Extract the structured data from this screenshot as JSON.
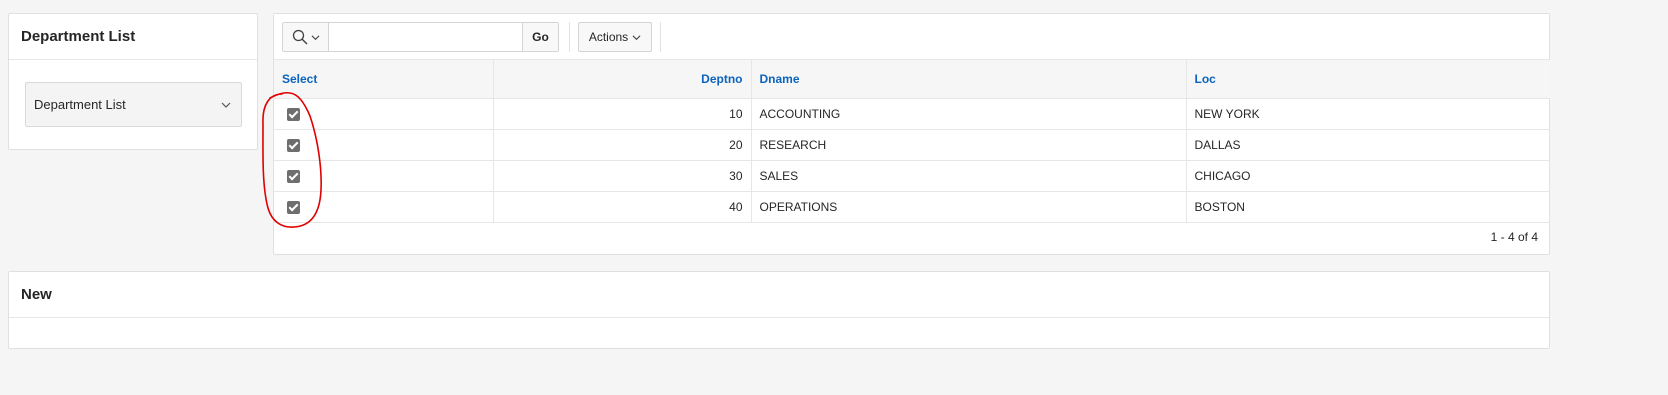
{
  "left_region": {
    "title": "Department List",
    "select_value": "Department List"
  },
  "report": {
    "toolbar": {
      "search_placeholder": "",
      "go_label": "Go",
      "actions_label": "Actions"
    },
    "columns": {
      "select": "Select",
      "deptno": "Deptno",
      "dname": "Dname",
      "loc": "Loc"
    },
    "rows": [
      {
        "deptno": "10",
        "dname": "ACCOUNTING",
        "loc": "NEW YORK",
        "checked": true
      },
      {
        "deptno": "20",
        "dname": "RESEARCH",
        "loc": "DALLAS",
        "checked": true
      },
      {
        "deptno": "30",
        "dname": "SALES",
        "loc": "CHICAGO",
        "checked": true
      },
      {
        "deptno": "40",
        "dname": "OPERATIONS",
        "loc": "BOSTON",
        "checked": true
      }
    ],
    "pagination": "1 - 4 of 4"
  },
  "new_region": {
    "title": "New"
  },
  "icons": {
    "search": "search-icon",
    "search_dropdown": "chevron-down-icon",
    "actions_dropdown": "chevron-down-icon",
    "select_dropdown": "chevron-down-icon"
  },
  "colors": {
    "header_link": "#0b64bd",
    "annotation": "#e00000",
    "checkbox": "#6e6e6e"
  }
}
